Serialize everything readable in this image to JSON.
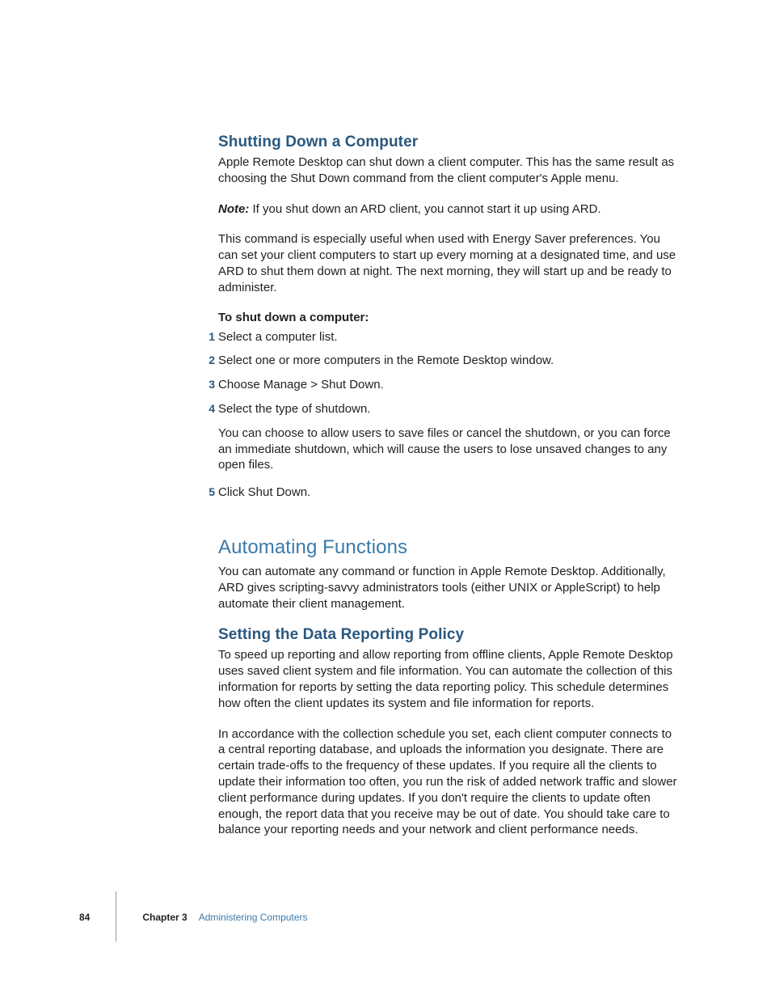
{
  "section1": {
    "heading": "Shutting Down a Computer",
    "intro": "Apple Remote Desktop can shut down a client computer. This has the same result as choosing the Shut Down command from the client computer's Apple menu.",
    "note_label": "Note:",
    "note_body": "  If you shut down an ARD client, you cannot start it up using ARD.",
    "para2": "This command is especially useful when used with Energy Saver preferences. You can set your client computers to start up every morning at a designated time, and use ARD to shut them down at night. The next morning, they will start up and be ready to administer.",
    "task_heading": "To shut down a computer:",
    "steps": {
      "n1": "1",
      "s1": "Select a computer list.",
      "n2": "2",
      "s2": "Select one or more computers in the Remote Desktop window.",
      "n3": "3",
      "s3": "Choose Manage > Shut Down.",
      "n4": "4",
      "s4": "Select the type of shutdown.",
      "s4_sub": "You can choose to allow users to save files or cancel the shutdown, or you can force an immediate shutdown, which will cause the users to lose unsaved changes to any open files.",
      "n5": "5",
      "s5": "Click Shut Down."
    }
  },
  "section2": {
    "heading": "Automating Functions",
    "intro": "You can automate any command or function in Apple Remote Desktop. Additionally, ARD gives scripting-savvy administrators tools (either UNIX or AppleScript) to help automate their client management.",
    "sub1": {
      "heading": "Setting the Data Reporting Policy",
      "p1": "To speed up reporting and allow reporting from offline clients, Apple Remote Desktop uses saved client system and file information. You can automate the collection of this information for reports by setting the data reporting policy. This schedule determines how often the client updates its system and file information for reports.",
      "p2": "In accordance with the collection schedule you set, each client computer connects to a central reporting database, and uploads the information you designate. There are certain trade-offs to the frequency of these updates. If you require all the clients to update their information too often, you run the risk of added network traffic and slower client performance during updates. If you don't require the clients to update often enough, the report data that you receive may be out of date. You should take care to balance your reporting needs and your network and client performance needs."
    }
  },
  "footer": {
    "page_number": "84",
    "chapter_label": "Chapter 3",
    "chapter_title": "Administering Computers"
  }
}
